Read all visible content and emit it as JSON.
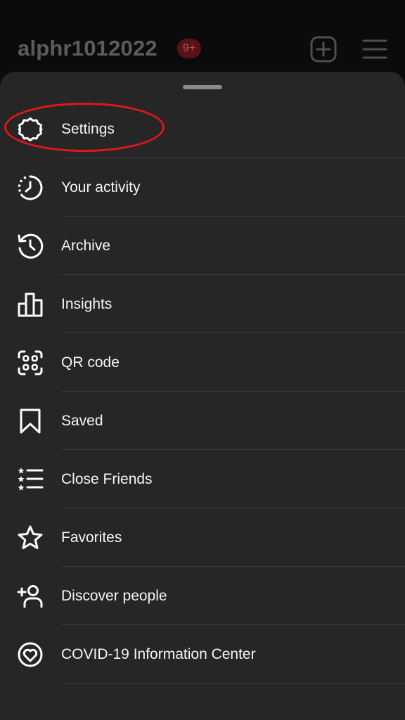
{
  "header": {
    "username": "alphr1012022",
    "badge": "9+"
  },
  "menu": {
    "items": [
      {
        "label": "Settings",
        "icon": "gear-icon"
      },
      {
        "label": "Your activity",
        "icon": "activity-icon"
      },
      {
        "label": "Archive",
        "icon": "archive-icon"
      },
      {
        "label": "Insights",
        "icon": "insights-icon"
      },
      {
        "label": "QR code",
        "icon": "qr-code-icon"
      },
      {
        "label": "Saved",
        "icon": "bookmark-icon"
      },
      {
        "label": "Close Friends",
        "icon": "close-friends-icon"
      },
      {
        "label": "Favorites",
        "icon": "star-icon"
      },
      {
        "label": "Discover people",
        "icon": "add-person-icon"
      },
      {
        "label": "COVID-19 Information Center",
        "icon": "heart-location-icon"
      }
    ]
  },
  "colors": {
    "sheet": "#262626",
    "annotation": "#e0161c",
    "badge": "#5a1216"
  }
}
